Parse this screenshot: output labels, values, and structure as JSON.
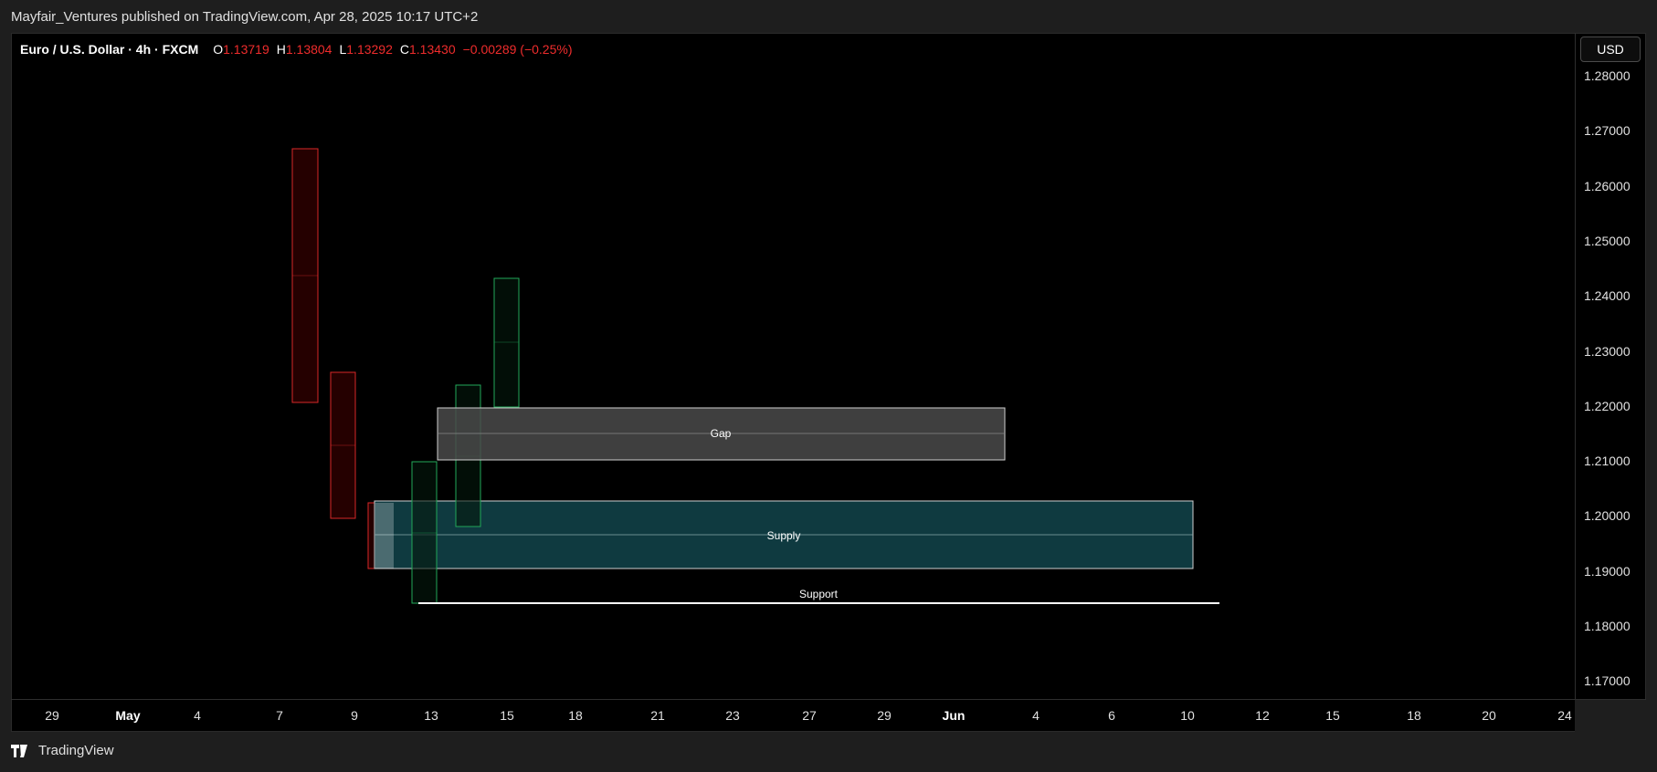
{
  "header": {
    "published_text": "Mayfair_Ventures published on TradingView.com, Apr 28, 2025 10:17 UTC+2"
  },
  "legend": {
    "symbol": "Euro / U.S. Dollar · 4h · FXCM",
    "o_label": "O",
    "o_value": "1.13719",
    "h_label": "H",
    "h_value": "1.13804",
    "l_label": "L",
    "l_value": "1.13292",
    "c_label": "C",
    "c_value": "1.13430",
    "change": "−0.00289 (−0.25%)"
  },
  "currency_button": "USD",
  "price_axis": [
    "1.28000",
    "1.27000",
    "1.26000",
    "1.25000",
    "1.24000",
    "1.23000",
    "1.22000",
    "1.21000",
    "1.20000",
    "1.19000",
    "1.18000",
    "1.17000"
  ],
  "time_axis": [
    {
      "label": "29",
      "bold": false
    },
    {
      "label": "May",
      "bold": true
    },
    {
      "label": "4",
      "bold": false
    },
    {
      "label": "7",
      "bold": false
    },
    {
      "label": "9",
      "bold": false
    },
    {
      "label": "13",
      "bold": false
    },
    {
      "label": "15",
      "bold": false
    },
    {
      "label": "18",
      "bold": false
    },
    {
      "label": "21",
      "bold": false
    },
    {
      "label": "23",
      "bold": false
    },
    {
      "label": "27",
      "bold": false
    },
    {
      "label": "29",
      "bold": false
    },
    {
      "label": "Jun",
      "bold": true
    },
    {
      "label": "4",
      "bold": false
    },
    {
      "label": "6",
      "bold": false
    },
    {
      "label": "10",
      "bold": false
    },
    {
      "label": "12",
      "bold": false
    },
    {
      "label": "15",
      "bold": false
    },
    {
      "label": "18",
      "bold": false
    },
    {
      "label": "20",
      "bold": false
    },
    {
      "label": "24",
      "bold": false
    }
  ],
  "zones": {
    "gap_label": "Gap",
    "supply_label": "Supply",
    "support_label": "Support"
  },
  "footer": {
    "brand": "TradingView"
  },
  "colors": {
    "bear": "#ef2c2c",
    "bull": "#22a85a",
    "supply_fill": "#0f3a40",
    "gap_fill": "#4a4a4a"
  }
}
